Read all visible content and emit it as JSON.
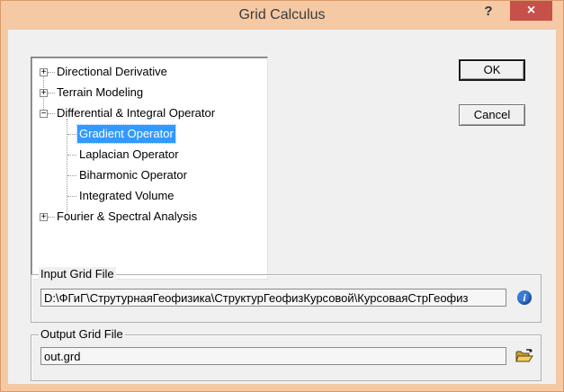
{
  "window": {
    "title": "Grid Calculus",
    "help_label": "?",
    "close_label": "×"
  },
  "tree": {
    "items": [
      {
        "label": "Directional Derivative",
        "expander": "+"
      },
      {
        "label": "Terrain Modeling",
        "expander": "+"
      },
      {
        "label": "Differential & Integral Operator",
        "expander": "−"
      },
      {
        "label": "Gradient Operator"
      },
      {
        "label": "Laplacian Operator"
      },
      {
        "label": "Biharmonic Operator"
      },
      {
        "label": "Integrated Volume"
      },
      {
        "label": "Fourier & Spectral Analysis",
        "expander": "+"
      }
    ],
    "selected": "Gradient Operator"
  },
  "buttons": {
    "ok_label": "OK",
    "cancel_label": "Cancel"
  },
  "input_grid": {
    "label": "Input Grid File",
    "value": "D:\\ФГиГ\\СтрутурнаяГеофизика\\СтруктурГеофизКурсовой\\КурсоваяСтрГеофиз"
  },
  "output_grid": {
    "label": "Output Grid File",
    "value": "out.grd"
  },
  "colors": {
    "titlebar": "#f4c9a4",
    "close": "#c7504a",
    "selection": "#3399ff"
  },
  "icons": {
    "input": "info-icon",
    "output": "open-folder-icon"
  }
}
